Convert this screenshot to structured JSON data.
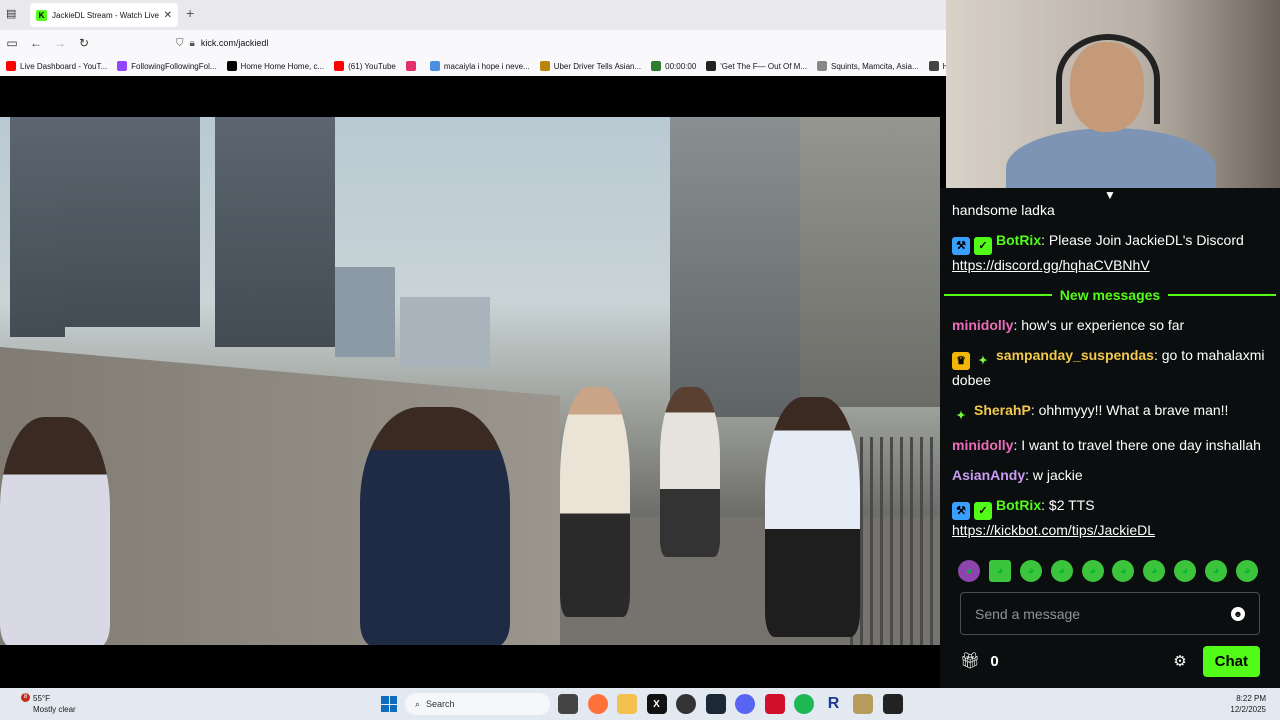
{
  "browser": {
    "tab_title": "JackieDL Stream - Watch Live o",
    "url": "kick.com/jackiedl",
    "bookmarks": [
      {
        "label": "Live Dashboard - YouT...",
        "color": "#ff0000"
      },
      {
        "label": "FollowingFollowingFol...",
        "color": "#9146ff"
      },
      {
        "label": "Home Home Home, c...",
        "color": "#000000"
      },
      {
        "label": "(61) YouTube",
        "color": "#ff0000"
      },
      {
        "label": "",
        "color": "#e1306c"
      },
      {
        "label": "macaiyla i hope i neve...",
        "color": "#4a90e2"
      },
      {
        "label": "Uber Driver Tells Asian...",
        "color": "#b8860b"
      },
      {
        "label": "00:00:00",
        "color": "#2e7d32"
      },
      {
        "label": "'Get The F— Out Of M...",
        "color": "#222222"
      },
      {
        "label": "Squints, Mamcita, Asia...",
        "color": "#888888"
      },
      {
        "label": "How Much",
        "color": "#444444"
      }
    ]
  },
  "chat": {
    "messages": [
      {
        "user": "",
        "user_color": "#ffffff",
        "badges": [],
        "text": "handsome ladka",
        "link": ""
      },
      {
        "user": "BotRix",
        "user_color": "#53fc18",
        "badges": [
          "bot",
          "verified"
        ],
        "text": "Please Join JackieDL's Discord",
        "link": "https://discord.gg/hqhaCVBNhV"
      }
    ],
    "divider": "New messages",
    "new_messages": [
      {
        "user": "minidolly",
        "user_color": "#e96dbb",
        "badges": [],
        "text": "how's ur experience so far",
        "link": ""
      },
      {
        "user": "sampanday_suspendas",
        "user_color": "#f2c94c",
        "badges": [
          "crown",
          "sparkle"
        ],
        "text": "go to mahalaxmi dobee",
        "link": ""
      },
      {
        "user": "SherahP",
        "user_color": "#f2c94c",
        "badges": [
          "sparkle"
        ],
        "text": "ohhmyyy!! What a brave man!!",
        "link": ""
      },
      {
        "user": "minidolly",
        "user_color": "#e96dbb",
        "badges": [],
        "text": "I want to travel there one day inshallah",
        "link": ""
      },
      {
        "user": "AsianAndy",
        "user_color": "#c89bf0",
        "badges": [],
        "text": "w jackie",
        "link": ""
      },
      {
        "user": "BotRix",
        "user_color": "#53fc18",
        "badges": [
          "bot",
          "verified"
        ],
        "text": "$2 TTS",
        "link": "https://kickbot.com/tips/JackieDL"
      }
    ],
    "input_placeholder": "Send a message",
    "points": "0",
    "chat_button": "Chat"
  },
  "taskbar": {
    "weather_badge": "8",
    "temperature": "55°F",
    "condition": "Mostly clear",
    "search_label": "Search",
    "time": "8:22 PM",
    "date": "12/2/2025"
  }
}
